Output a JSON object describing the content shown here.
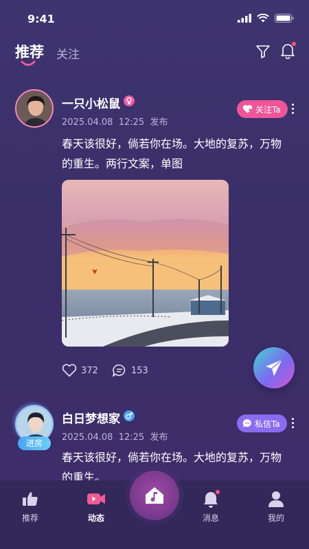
{
  "status_bar": {
    "time": "9:41"
  },
  "header": {
    "tabs": [
      {
        "label": "推荐",
        "active": true
      },
      {
        "label": "关注",
        "active": false
      }
    ],
    "has_notification_dot": true
  },
  "posts": [
    {
      "username": "一只小松鼠",
      "badge_icon": "female-badge-icon",
      "date": "2025.04.08",
      "time": "12:25",
      "published": "发布",
      "action_label": "关注Ta",
      "text": "春天该很好，倘若你在场。大地的复苏，万物的重生。两行文案，单图",
      "text_line1": "春天该很好，倘若你在场。大地的复苏，万物",
      "text_line2": "的重生。两行文案，单图",
      "image": "snowy-road-sunset-photo",
      "likes": "372",
      "comments": "153"
    },
    {
      "username": "白日梦想家",
      "badge_icon": "male-badge-icon",
      "date": "2025.04.08",
      "time": "12:25",
      "published": "发布",
      "room_label": "进房",
      "action_label": "私信Ta",
      "text_line1": "春天该很好，倘若你在场。大地的复苏，万物",
      "text_line2": "的重生。"
    }
  ],
  "bottom_nav": [
    {
      "label": "推荐",
      "icon": "thumbs-up-icon"
    },
    {
      "label": "动态",
      "icon": "video-camera-icon",
      "active": true
    },
    {
      "label": "",
      "icon": "music-home-icon"
    },
    {
      "label": "消息",
      "icon": "bell-icon",
      "has_dot": true
    },
    {
      "label": "我的",
      "icon": "profile-icon"
    }
  ],
  "colors": {
    "accent_pink": "#f0559a",
    "accent_purple": "#8b6cf0",
    "nav_bg": "#33285a"
  }
}
